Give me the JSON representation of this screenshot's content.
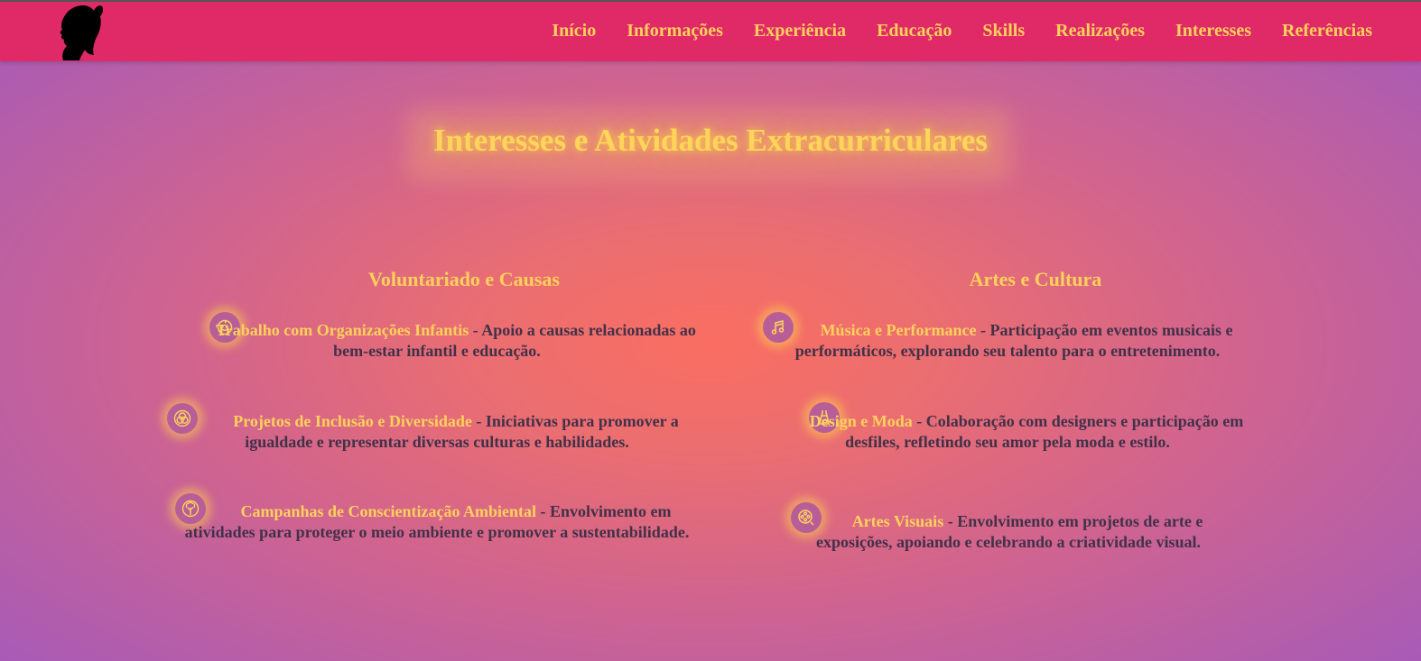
{
  "nav": {
    "logo_icon": "silhouette-ponytail-logo",
    "links": [
      "Início",
      "Informações",
      "Experiência",
      "Educação",
      "Skills",
      "Realizações",
      "Interesses",
      "Referências"
    ]
  },
  "section_title": "Interesses e Atividades Extracurriculares",
  "columns": [
    {
      "title": "Voluntariado e Causas",
      "items": [
        {
          "icon": "child-smile-icon",
          "title": "Trabalho com Organizações Infantis",
          "description": "Apoio a causas relacionadas ao bem-estar infantil e educação."
        },
        {
          "icon": "diversity-circles-icon",
          "title": "Projetos de Inclusão e Diversidade",
          "description": "Iniciativas para promover a igualdade e representar diversas culturas e habilidades."
        },
        {
          "icon": "tree-icon",
          "title": "Campanhas de Conscientização Ambiental",
          "description": "Envolvimento em atividades para proteger o meio ambiente e promover a sustentabilidade."
        }
      ]
    },
    {
      "title": "Artes e Cultura",
      "items": [
        {
          "icon": "music-note-icon",
          "title": "Música e Performance",
          "description": "Participação em eventos musicais e performáticos, explorando seu talento para o entretenimento."
        },
        {
          "icon": "dress-icon",
          "title": "Design e Moda",
          "description": "Colaboração com designers e participação em desfiles, refletindo seu amor pela moda e estilo."
        },
        {
          "icon": "film-reel-icon",
          "title": "Artes Visuais",
          "description": "Envolvimento em projetos de arte e exposições, apoiando e celebrando a criatividade visual."
        }
      ]
    }
  ],
  "separator": " - ",
  "colors": {
    "navbar": "#e02a68",
    "accent": "#fed15b",
    "text": "#413149"
  }
}
